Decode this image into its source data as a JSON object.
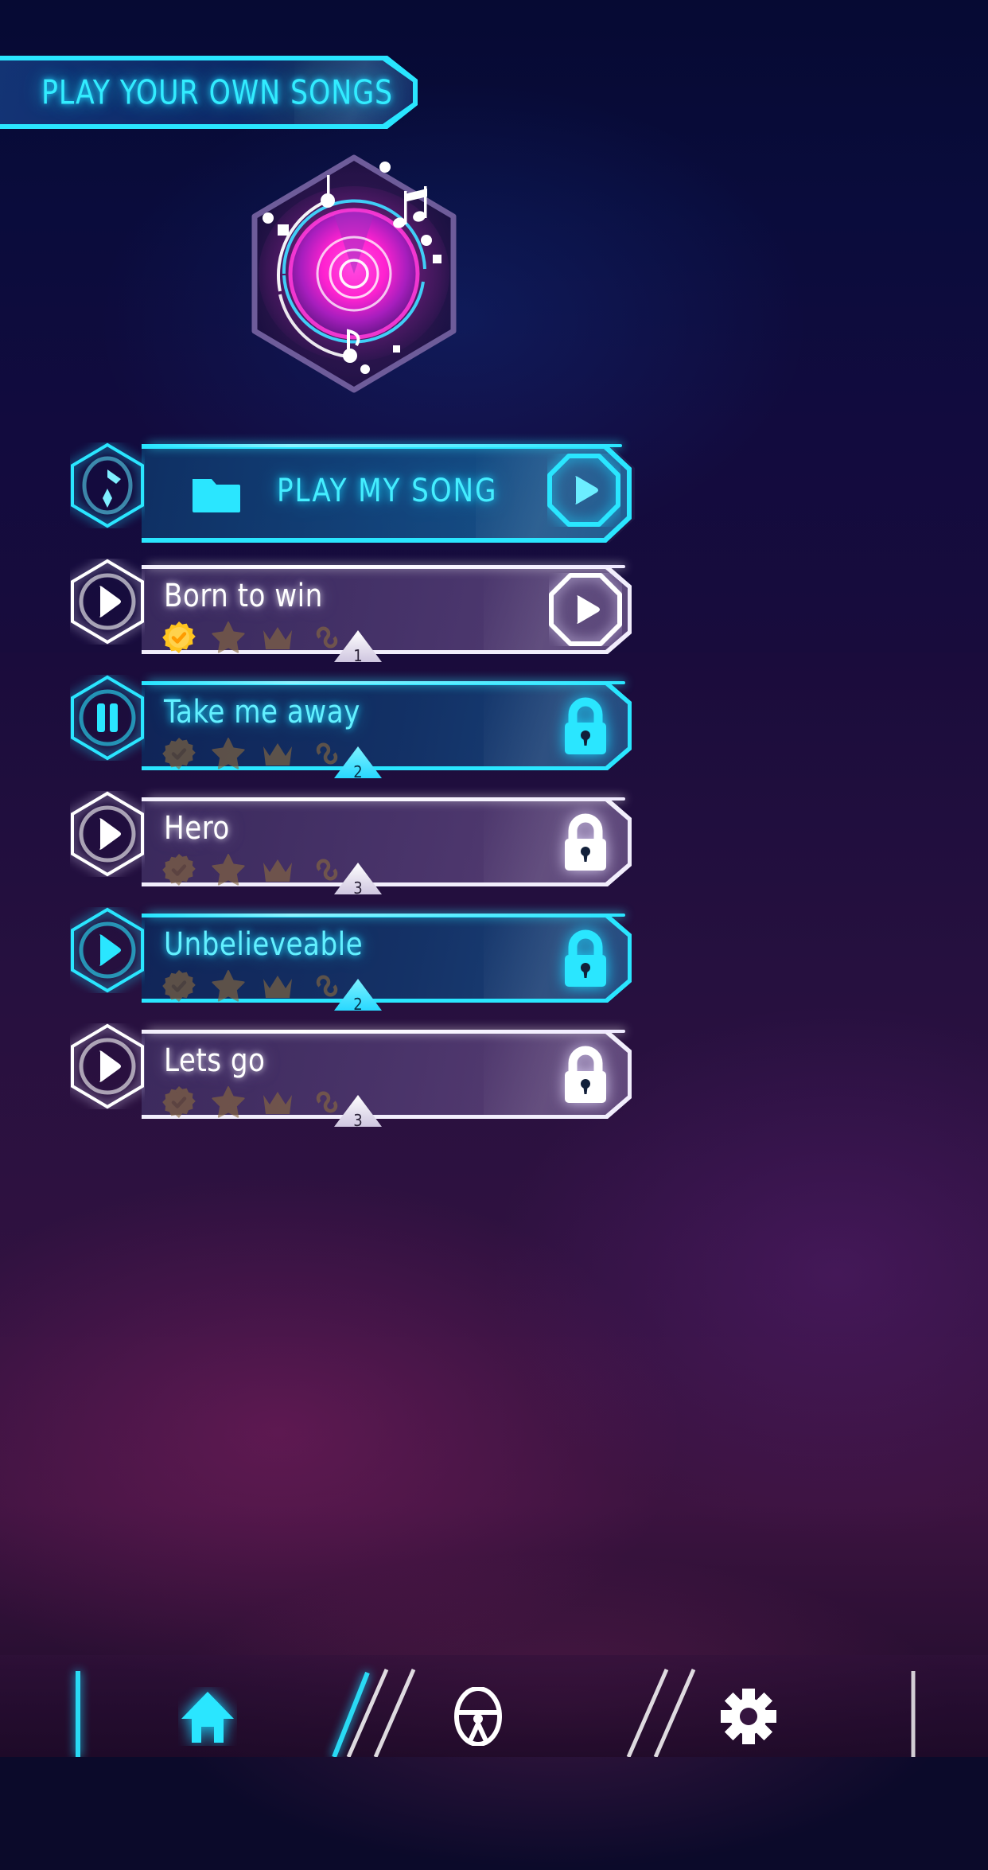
{
  "theme": {
    "cyan": "#2ae6ff",
    "cyan_text": "#44eeff",
    "white": "#ffffff",
    "magenta": "#ff22d0",
    "gold": "#ffc41f",
    "dim_medal": "#8a6a3e",
    "bg_dark": "#0b0a2a"
  },
  "header": {
    "title": "PLAY YOUR OWN SONGS"
  },
  "logo": {
    "name": "hexagon-music-disc-logo",
    "hex_stroke": "#6e5c9a",
    "disc_outer": "#ff22d0",
    "disc_inner": "#b21ec4",
    "ring_cyan": "#3fd8ff"
  },
  "play_my_song": {
    "label": "PLAY MY SONG",
    "badge_icon": "music-note-hexagon-icon",
    "folder_icon": "folder-icon",
    "action_icon": "play-icon",
    "style": "cyan"
  },
  "songs": [
    {
      "title": "Born to win",
      "badge_icon": "play-icon",
      "action_icon": "play-icon",
      "difficulty": "1",
      "style": "purple",
      "medals": [
        {
          "name": "check-badge-medal",
          "earned": true
        },
        {
          "name": "star-medal",
          "earned": false
        },
        {
          "name": "crown-medal",
          "earned": false
        },
        {
          "name": "infinity-medal",
          "earned": false
        }
      ]
    },
    {
      "title": "Take me away",
      "badge_icon": "pause-icon",
      "action_icon": "lock-icon",
      "difficulty": "2",
      "style": "cyan",
      "medals": [
        {
          "name": "check-badge-medal",
          "earned": false
        },
        {
          "name": "star-medal",
          "earned": false
        },
        {
          "name": "crown-medal",
          "earned": false
        },
        {
          "name": "infinity-medal",
          "earned": false
        }
      ]
    },
    {
      "title": "Hero",
      "badge_icon": "play-icon",
      "action_icon": "lock-icon",
      "difficulty": "3",
      "style": "purple",
      "medals": [
        {
          "name": "check-badge-medal",
          "earned": false
        },
        {
          "name": "star-medal",
          "earned": false
        },
        {
          "name": "crown-medal",
          "earned": false
        },
        {
          "name": "infinity-medal",
          "earned": false
        }
      ]
    },
    {
      "title": "Unbelieveable",
      "badge_icon": "play-icon",
      "action_icon": "lock-icon",
      "difficulty": "2",
      "style": "cyan",
      "medals": [
        {
          "name": "check-badge-medal",
          "earned": false
        },
        {
          "name": "star-medal",
          "earned": false
        },
        {
          "name": "crown-medal",
          "earned": false
        },
        {
          "name": "infinity-medal",
          "earned": false
        }
      ]
    },
    {
      "title": "Lets go",
      "badge_icon": "play-icon",
      "action_icon": "lock-icon",
      "difficulty": "3",
      "style": "purple",
      "medals": [
        {
          "name": "check-badge-medal",
          "earned": false
        },
        {
          "name": "star-medal",
          "earned": false
        },
        {
          "name": "crown-medal",
          "earned": false
        },
        {
          "name": "infinity-medal",
          "earned": false
        }
      ]
    }
  ],
  "bottom_nav": [
    {
      "name": "home-icon",
      "active": true
    },
    {
      "name": "steering-wheel-icon",
      "active": false
    },
    {
      "name": "gear-icon",
      "active": false
    }
  ]
}
